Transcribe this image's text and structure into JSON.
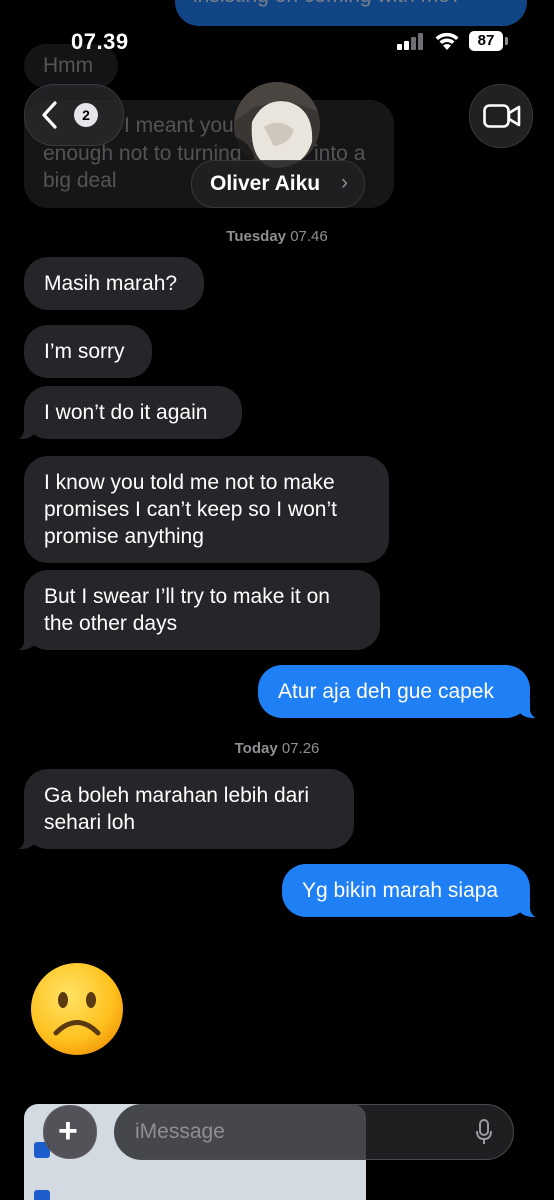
{
  "status_bar": {
    "time": "07.39",
    "battery": "87",
    "colors": {
      "battery_bg": "#ffffff"
    }
  },
  "header": {
    "back_badge": "2",
    "contact_name": "Oliver Aiku",
    "chevron": "›",
    "icons": [
      "back-chevron-icon",
      "video-camera-icon",
      "contact-avatar"
    ]
  },
  "background_messages": {
    "top_cut_text": "insisting on coming with me?",
    "hmm": "Hmm",
    "partial_line_1": "I meant you were",
    "partial_line_1b": "into a",
    "partial_line_2": "enough not to turning",
    "partial_line_3": "big deal"
  },
  "timestamps": [
    {
      "day": "Tuesday",
      "time": "07.46"
    },
    {
      "day": "Today",
      "time": "07.26"
    }
  ],
  "messages": [
    {
      "from": "them",
      "text": "Masih marah?"
    },
    {
      "from": "them",
      "text": "I’m sorry"
    },
    {
      "from": "them",
      "text": "I won’t do it again"
    },
    {
      "from": "them",
      "text": "I know you told me not to make promises I can’t keep so I won’t promise anything"
    },
    {
      "from": "them",
      "text": "But I swear I’ll try to make it on the other days"
    },
    {
      "from": "me",
      "text": "Atur aja deh gue capek"
    },
    {
      "from": "them",
      "text": "Ga boleh marahan lebih dari sehari loh"
    },
    {
      "from": "me",
      "text": "Yg bikin marah siapa"
    },
    {
      "from": "them",
      "text": "☹️",
      "kind": "emoji"
    }
  ],
  "composer": {
    "plus": "+",
    "placeholder": "iMessage",
    "icons": [
      "plus-icon",
      "microphone-icon"
    ]
  },
  "colors": {
    "background": "#000000",
    "incoming_bubble": "#26252a",
    "outgoing_bubble": "#1f7ff4",
    "timestamp": "#8e8e93"
  }
}
